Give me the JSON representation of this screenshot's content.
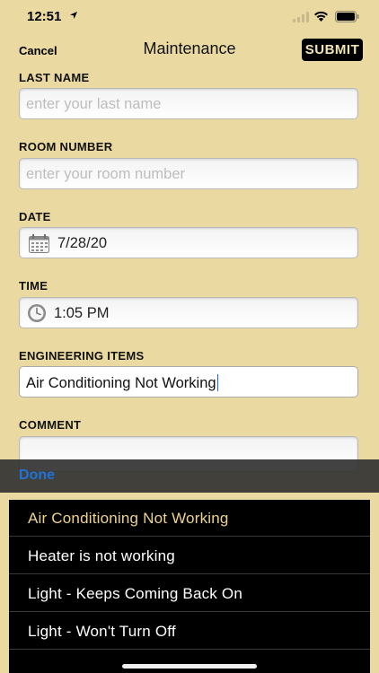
{
  "status_bar": {
    "time": "12:51"
  },
  "nav": {
    "cancel_label": "Cancel",
    "title": "Maintenance",
    "submit_label": "SUBMIT"
  },
  "form": {
    "last_name": {
      "label": "LAST NAME",
      "placeholder": "enter your last name",
      "value": ""
    },
    "room_number": {
      "label": "ROOM NUMBER",
      "placeholder": "enter your room number",
      "value": ""
    },
    "date": {
      "label": "DATE",
      "value": "7/28/20"
    },
    "time": {
      "label": "TIME",
      "value": "1:05 PM"
    },
    "engineering_items": {
      "label": "ENGINEERING ITEMS",
      "value": "Air Conditioning Not Working"
    },
    "comment": {
      "label": "COMMENT",
      "value": ""
    }
  },
  "keyboard_toolbar": {
    "done_label": "Done"
  },
  "picker": {
    "items": [
      {
        "label": "Air Conditioning Not Working",
        "selected": true
      },
      {
        "label": "Heater is not working",
        "selected": false
      },
      {
        "label": "Light - Keeps Coming Back On",
        "selected": false
      },
      {
        "label": "Light - Won't Turn Off",
        "selected": false
      }
    ]
  },
  "colors": {
    "background": "#ead9a1",
    "accent_selected": "#eed28f",
    "done_blue": "#1f73d8"
  }
}
